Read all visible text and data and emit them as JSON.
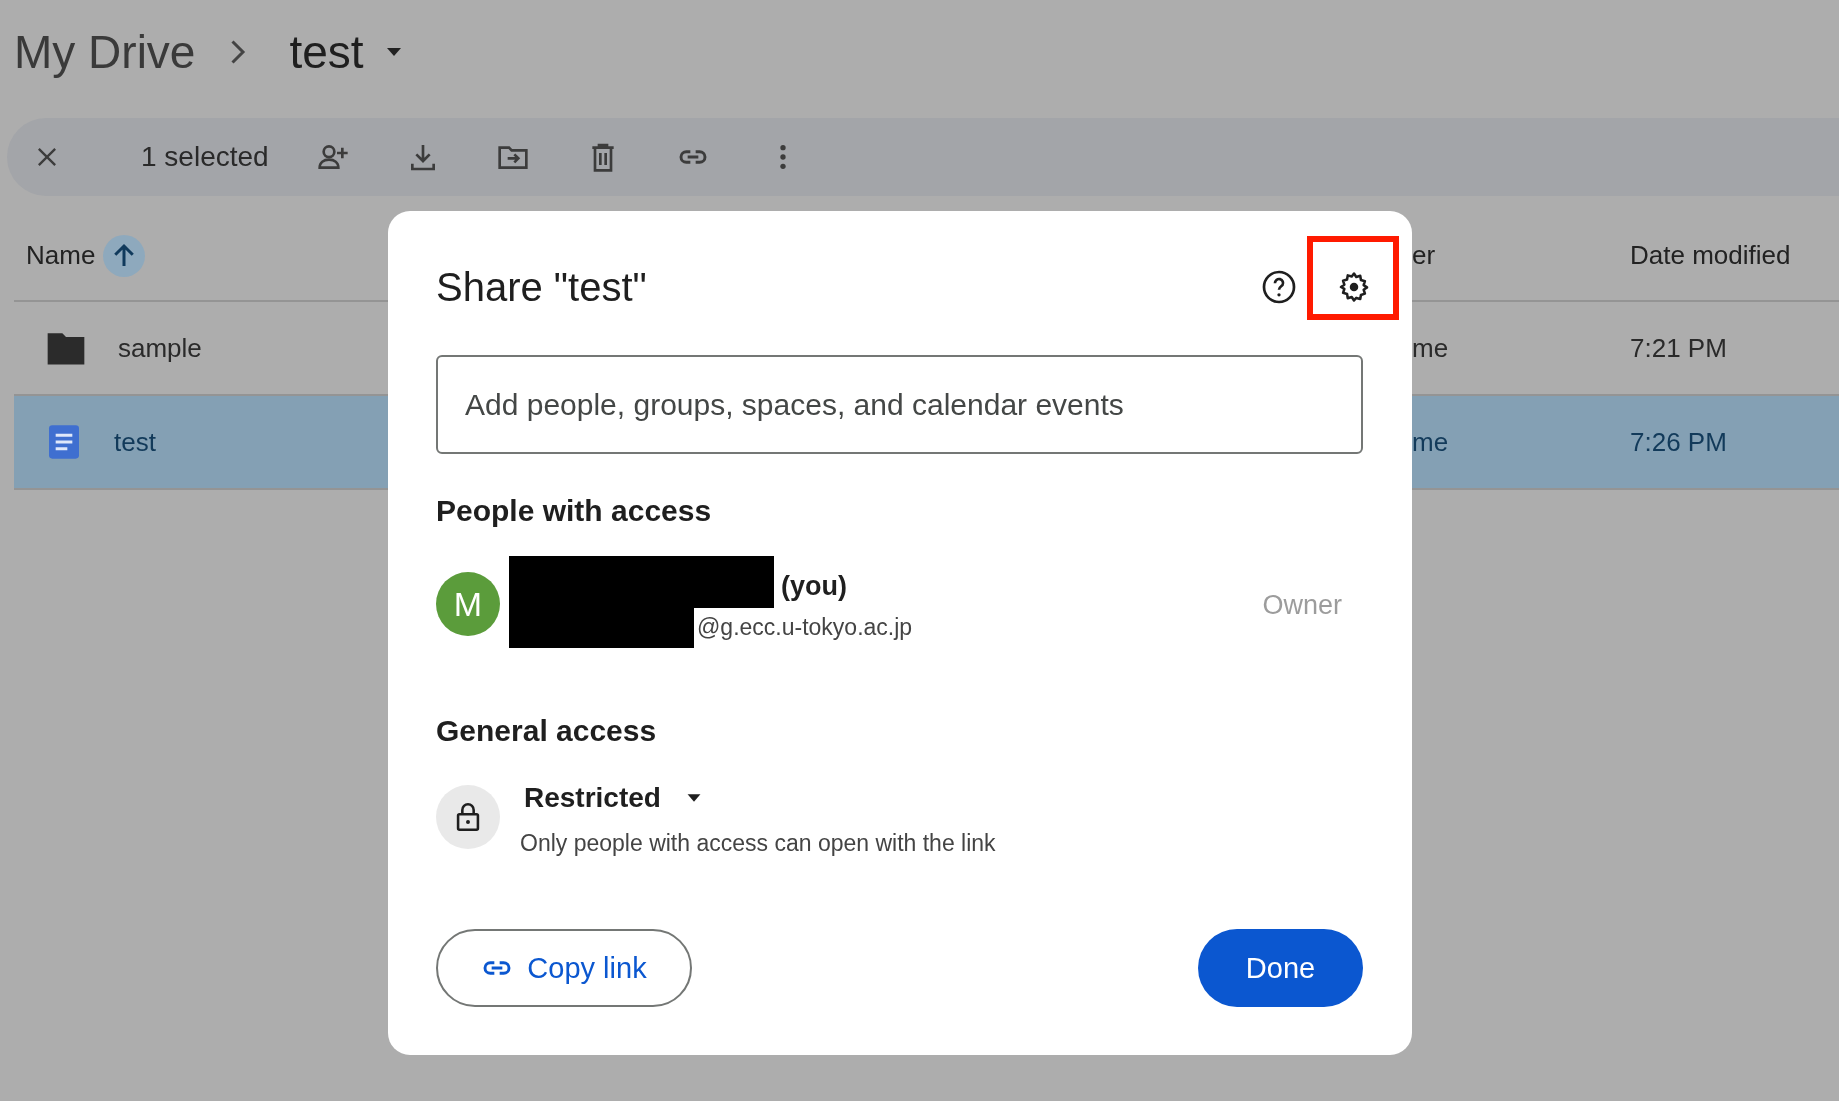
{
  "breadcrumb": {
    "parent": "My Drive",
    "current": "test"
  },
  "toolbar": {
    "selection": "1 selected"
  },
  "table": {
    "columns": [
      "Name",
      "er",
      "Date modified"
    ],
    "rows": [
      {
        "name": "sample",
        "kind": "folder",
        "column_2": "me",
        "date_modified": "7:21 PM",
        "selected": false
      },
      {
        "name": "test",
        "kind": "document",
        "column_2": "me",
        "date_modified": "7:26 PM",
        "selected": true
      }
    ]
  },
  "dialog": {
    "title": "Share \"test\"",
    "settings_highlighted": true,
    "search": {
      "placeholder": "Add people, groups, spaces, and calendar events"
    },
    "people_heading": "People with access",
    "people": [
      {
        "initial": "M",
        "color": "#5b9c3b",
        "name_redacted": true,
        "you": "(you)",
        "email": "@g.ecc.u-tokyo.ac.jp",
        "role": "Owner"
      }
    ],
    "general_heading": "General access",
    "access": {
      "level": "Restricted",
      "description": "Only people with access can open with the link"
    },
    "copy_link": "Copy link",
    "done": "Done"
  }
}
